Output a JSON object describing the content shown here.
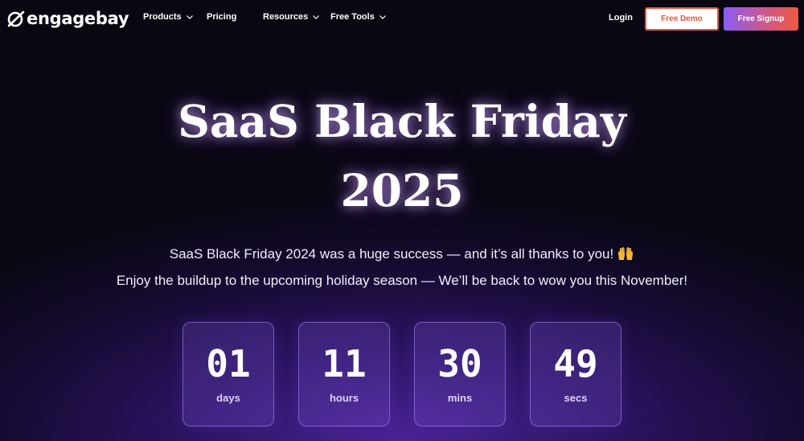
{
  "nav": {
    "logo_text": "engagebay",
    "items": [
      {
        "label": "Products",
        "has_dropdown": true
      },
      {
        "label": "Pricing",
        "has_dropdown": false
      },
      {
        "label": "Resources",
        "has_dropdown": true
      },
      {
        "label": "Free Tools",
        "has_dropdown": true
      }
    ],
    "login_label": "Login",
    "demo_label": "Free Demo",
    "signup_label": "Free Signup"
  },
  "hero": {
    "title_line1": "SaaS Black Friday",
    "title_line2": "2025",
    "subtitle_line1": "SaaS Black Friday 2024 was a huge success — and it’s all thanks to you!",
    "subtitle_line2": "Enjoy the buildup to the upcoming holiday season — We’ll be back to wow you this November!",
    "emoji_icon": "raising-hands-icon"
  },
  "countdown": [
    {
      "value": "01",
      "unit": "days"
    },
    {
      "value": "11",
      "unit": "hours"
    },
    {
      "value": "30",
      "unit": "mins"
    },
    {
      "value": "49",
      "unit": "secs"
    }
  ],
  "colors": {
    "accent_orange": "#e6553f",
    "signup_gradient_start": "#8b5cf6",
    "signup_gradient_end": "#ef5a3c",
    "background_dark": "#0a0712",
    "background_purple": "#4a2496"
  }
}
